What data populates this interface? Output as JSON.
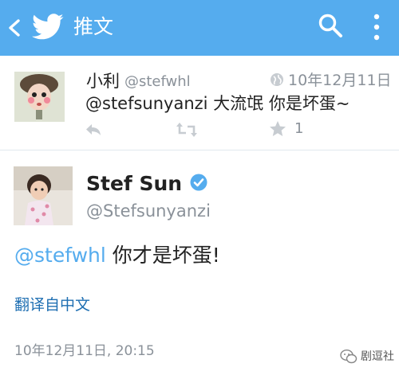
{
  "header": {
    "title": "推文",
    "bg": "#55acee"
  },
  "reply": {
    "name": "小利",
    "handle": "@stefwhl",
    "date": "10年12月11日",
    "text": "@stefsunyanzi  大流氓 你是坏蛋~",
    "favorite_count": "1"
  },
  "tweet": {
    "name": "Stef Sun",
    "handle": "@Stefsunyanzi",
    "mention": "@stefwhl",
    "text": " 你才是坏蛋!",
    "translate_link": "翻译自中文",
    "timestamp": "10年12月11日, 20:15"
  },
  "watermark": {
    "text": "剧逗社"
  },
  "colors": {
    "accent": "#55acee",
    "muted": "#8a9199",
    "link": "#1f6fb2"
  }
}
